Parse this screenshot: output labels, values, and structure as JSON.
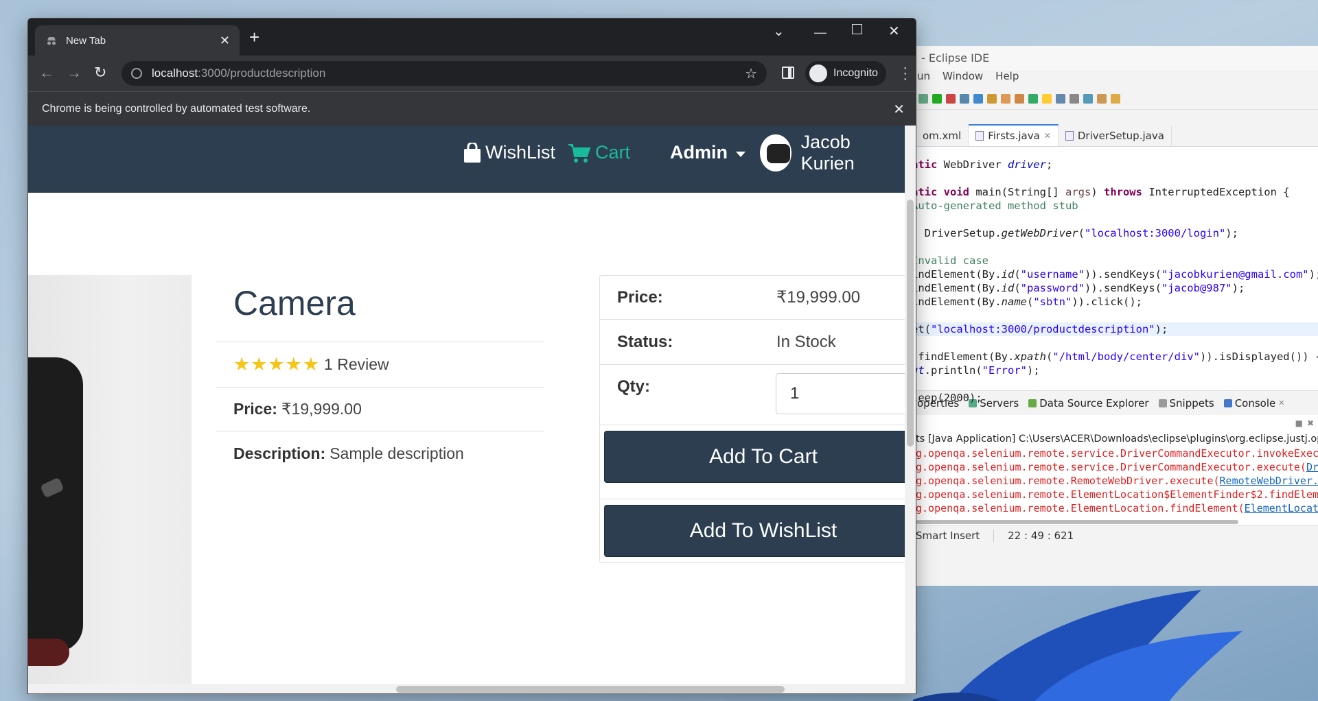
{
  "eclipse": {
    "title": "- Eclipse IDE",
    "menu": [
      "un",
      "Window",
      "Help"
    ],
    "tabs": [
      {
        "label": "om.xml",
        "active": false
      },
      {
        "label": "Firsts.java",
        "active": true
      },
      {
        "label": "DriverSetup.java",
        "active": false
      }
    ],
    "code": [
      "atic WebDriver driver;",
      "",
      "atic void main(String[] args) throws InterruptedException {",
      "Auto-generated method stub",
      "",
      " DriverSetup.getWebDriver(\"localhost:3000/login\");",
      "",
      "Invalid case",
      "indElement(By.id(\"username\")).sendKeys(\"jacobkurien@gmail.com\");",
      "indElement(By.id(\"password\")).sendKeys(\"jacob@987\");",
      "indElement(By.name(\"sbtn\")).click();",
      "",
      "et(\"localhost:3000/productdescription\");",
      "",
      ".findElement(By.xpath(\"/html/body/center/div\")).isDisplayed()) {",
      "ut.println(\"Error\");",
      "",
      "leep(2000);"
    ],
    "views": [
      "operties",
      "Servers",
      "Data Source Explorer",
      "Snippets",
      "Console"
    ],
    "console_header": "ts [Java Application] C:\\Users\\ACER\\Downloads\\eclipse\\plugins\\org.eclipse.justj.openjdk",
    "console_lines": [
      {
        "text": "g.openqa.selenium.remote.service.DriverCommandExecutor.invokeExec",
        "link": ""
      },
      {
        "text": "g.openqa.selenium.remote.service.DriverCommandExecutor.execute(",
        "link": "Dr"
      },
      {
        "text": "g.openqa.selenium.remote.RemoteWebDriver.execute(",
        "link": "RemoteWebDriver."
      },
      {
        "text": "g.openqa.selenium.remote.ElementLocation$ElementFinder$2.findElem",
        "link": ""
      },
      {
        "text": "g.openqa.selenium.remote.ElementLocation.findElement(",
        "link": "ElementLocat"
      }
    ],
    "status": {
      "mode": "Smart Insert",
      "position": "22 : 49 : 621"
    }
  },
  "chrome": {
    "tab_title": "New Tab",
    "url_host": "localhost",
    "url_path": ":3000/productdescription",
    "profile": "Incognito",
    "infobar": "Chrome is being controlled by automated test software."
  },
  "site": {
    "nav": {
      "wishlist": "WishList",
      "cart": "Cart",
      "admin": "Admin",
      "user": "Jacob Kurien"
    },
    "product": {
      "name": "Camera",
      "rating": 5,
      "stars": "★★★★★",
      "reviews": "1 Review",
      "price_label": "Price:",
      "price": "₹19,999.00",
      "description_label": "Description:",
      "description": "Sample description"
    },
    "purchase": {
      "price_label": "Price:",
      "price": "₹19,999.00",
      "status_label": "Status:",
      "status": "In Stock",
      "qty_label": "Qty:",
      "qty": "1",
      "add_to_cart": "Add To Cart",
      "add_to_wishlist": "Add To WishList"
    },
    "colors": {
      "navbar": "#2c3e50",
      "cart": "#18bc9c",
      "star": "#f5c518"
    }
  }
}
